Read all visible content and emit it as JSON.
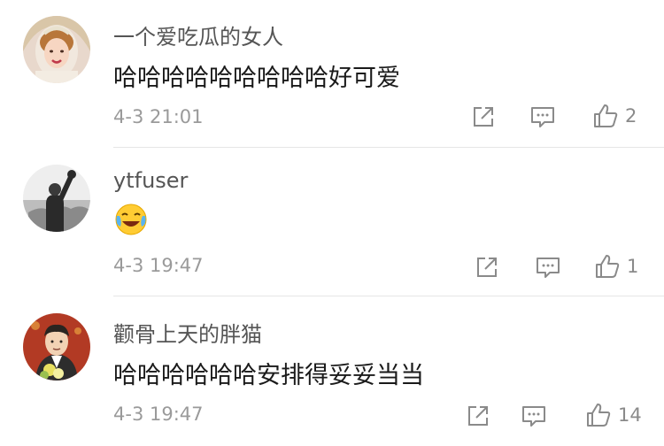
{
  "comments": [
    {
      "username": "一个爱吃瓜的女人",
      "content": "哈哈哈哈哈哈哈哈哈好可爱",
      "timestamp": "4-3 21:01",
      "like_count": "2",
      "avatar_icon": "avatar-bride-photo"
    },
    {
      "username": "ytfuser",
      "content": "",
      "emoji_icon": "laughing-crying-emoji",
      "timestamp": "4-3 19:47",
      "like_count": "1",
      "avatar_icon": "avatar-bw-fist-photo"
    },
    {
      "username": "颧骨上天的胖猫",
      "content": "哈哈哈哈哈哈安排得妥妥当当",
      "timestamp": "4-3 19:47",
      "like_count": "14",
      "avatar_icon": "avatar-suit-flowers-photo"
    }
  ],
  "actions": {
    "share_icon": "share-icon",
    "reply_icon": "reply-icon",
    "like_icon": "thumbs-up-icon"
  },
  "colors": {
    "username": "#555555",
    "timestamp": "#9a9a9a",
    "icon": "#8a8a8a",
    "divider": "#e6e6e6"
  }
}
